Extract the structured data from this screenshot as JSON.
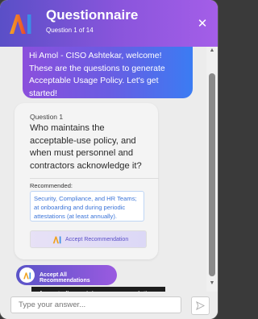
{
  "header": {
    "title": "Questionnaire",
    "subtitle": "Question 1 of 14",
    "close_icon": "close-icon",
    "logo_icon": "ai-logo-icon"
  },
  "welcome": {
    "text": "Hi Amol - CISO Ashtekar, welcome! These are the questions to generate Acceptable Usage Policy. Let's get started!"
  },
  "question": {
    "label": "Question 1",
    "text": "Who maintains the acceptable-use policy, and when must personnel and contractors acknowledge it?",
    "recommended_label": "Recommended:",
    "recommendation": "Security, Compliance, and HR Teams; at onboarding and during periodic attestations (at least annually).",
    "accept_label": "Accept Recommendation"
  },
  "accept_all": {
    "label": "Accept All Recommendations",
    "tooltip": "Accept all remaining recommendations"
  },
  "input": {
    "placeholder": "Type your answer...",
    "send_icon": "send-icon"
  },
  "colors": {
    "accent": "#5a4fc7",
    "brand_gradient_start": "#5a4fc7",
    "brand_gradient_end": "#a45ee8",
    "link_blue": "#3b74d8"
  }
}
